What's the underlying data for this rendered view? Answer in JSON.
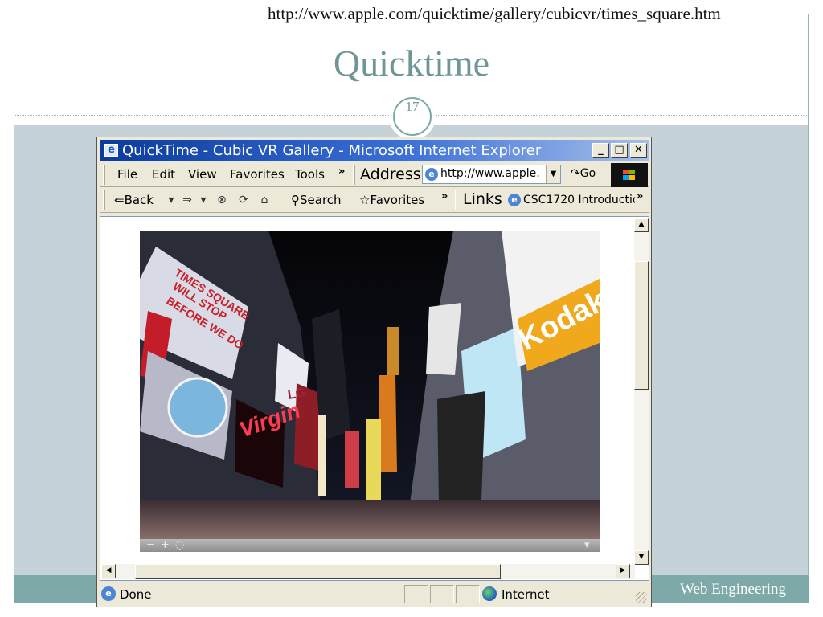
{
  "slide": {
    "url": "http://www.apple.com/quicktime/gallery/cubicvr/times_square.htm",
    "title": "Quicktime",
    "page_number": "17",
    "footer": "– Web Engineering"
  },
  "browser": {
    "window_title": "QuickTime - Cubic VR Gallery - Microsoft Internet Explorer",
    "caption_buttons": {
      "minimize": "_",
      "maximize": "□",
      "close": "✕"
    },
    "menu": [
      "File",
      "Edit",
      "View",
      "Favorites",
      "Tools"
    ],
    "menu_overflow": "»",
    "address_label": "Address",
    "address_value": "http://www.apple.",
    "go_label": "Go",
    "toolbar": {
      "back": "Back",
      "search": "Search",
      "favorites": "Favorites",
      "overflow": "»"
    },
    "links_label": "Links",
    "links_item": "CSC1720 Introductio",
    "links_overflow": "»",
    "status_text": "Done",
    "zone_text": "Internet"
  },
  "photo": {
    "signs": [
      "TIMES SQUARE",
      "WILL STOP",
      "BEFORE WE DO",
      "Kodak",
      "Virgin",
      "LG"
    ]
  },
  "colors": {
    "slide_band": "#c5d3d8",
    "slide_title": "#6e9696",
    "footer_band": "#7ea9a9",
    "ie_title_start": "#0a3a9c",
    "ie_title_end": "#a6c0ea",
    "ie_chrome": "#ece9d8"
  }
}
